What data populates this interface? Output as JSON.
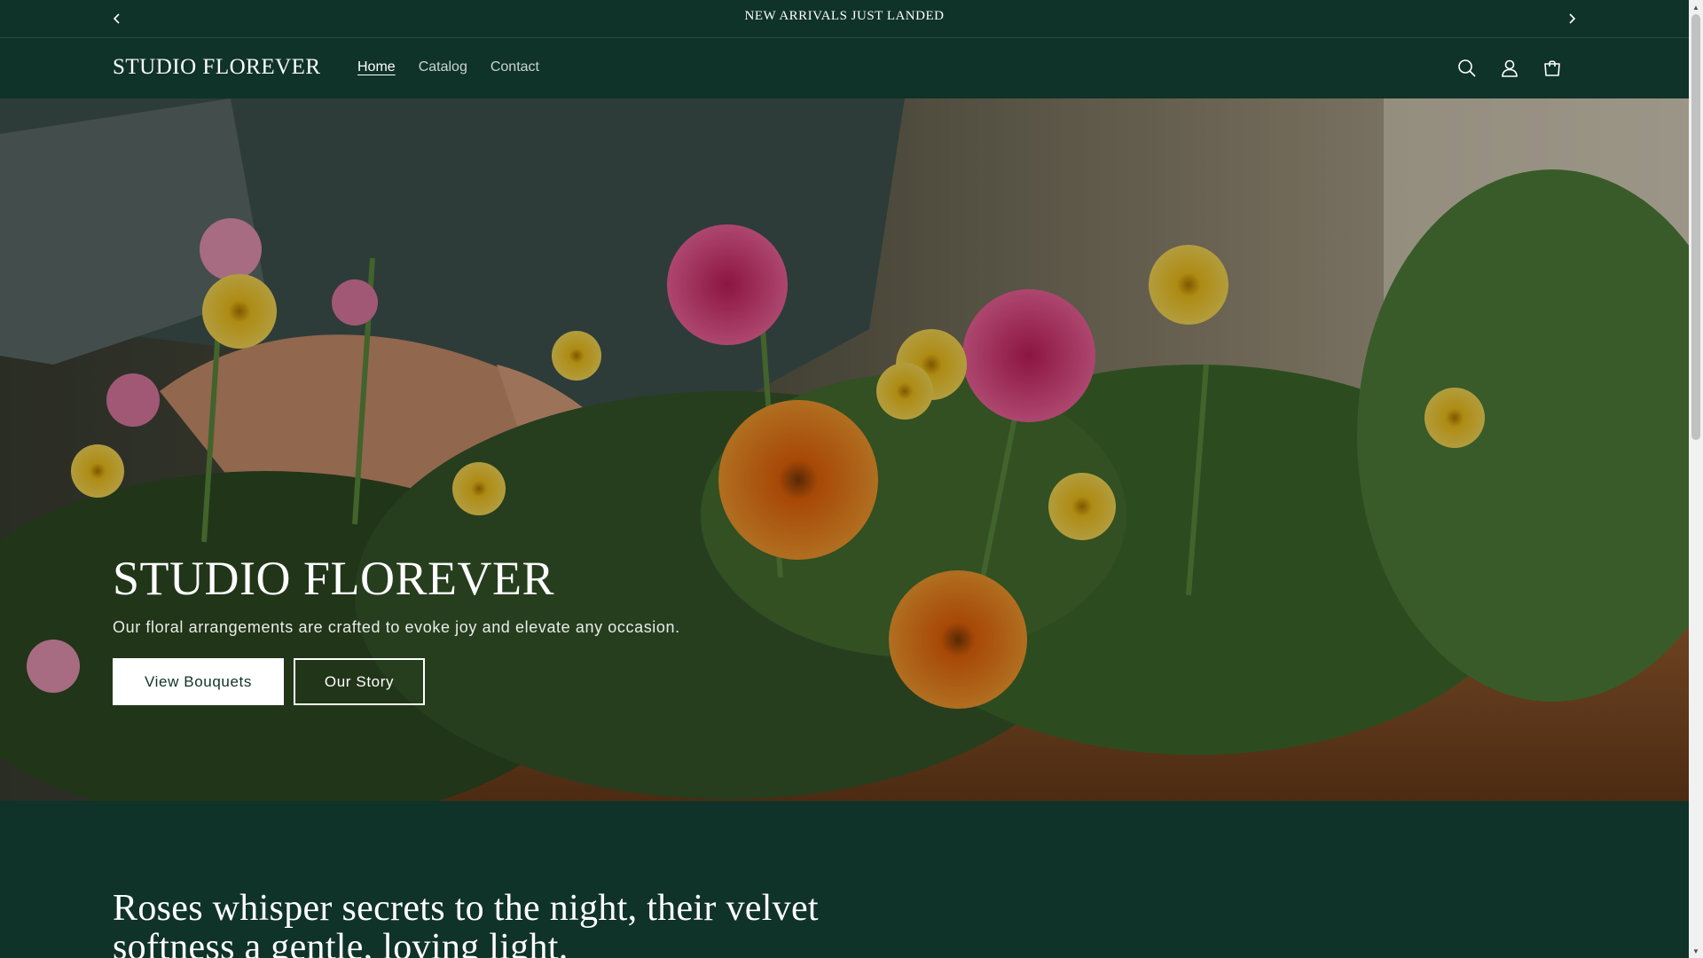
{
  "announcement": {
    "text": "NEW ARRIVALS JUST LANDED",
    "prev_icon": "chevron-left-icon",
    "next_icon": "chevron-right-icon"
  },
  "header": {
    "logo": "STUDIO FLOREVER",
    "nav": [
      {
        "label": "Home",
        "active": true
      },
      {
        "label": "Catalog",
        "active": false
      },
      {
        "label": "Contact",
        "active": false
      }
    ],
    "icons": [
      "search-icon",
      "account-icon",
      "cart-icon"
    ]
  },
  "hero": {
    "title": "STUDIO FLOREVER",
    "subtitle": "Our floral arrangements are crafted to evoke joy and elevate any occasion.",
    "primary_button": "View Bouquets",
    "secondary_button": "Our Story"
  },
  "quote": {
    "text": "Roses whisper secrets to the night, their velvet softness a gentle, loving light."
  },
  "colors": {
    "brand_dark_green": "#0f3328",
    "text_white": "#ffffff"
  }
}
